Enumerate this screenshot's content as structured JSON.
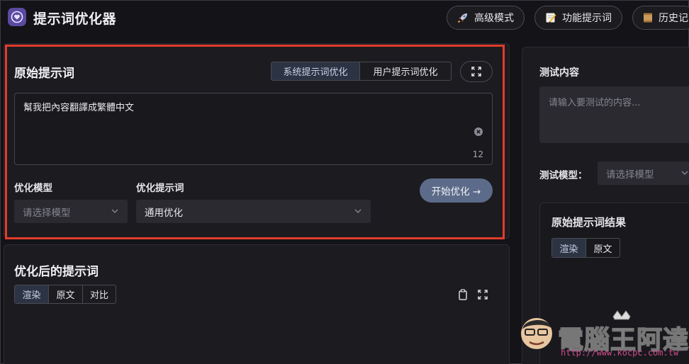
{
  "header": {
    "title": "提示词优化器",
    "buttons": [
      {
        "label": "高级模式",
        "icon": "rocket-icon"
      },
      {
        "label": "功能提示词",
        "icon": "pencil-icon"
      },
      {
        "label": "历史记",
        "icon": "scroll-icon"
      }
    ]
  },
  "original": {
    "title": "原始提示词",
    "tabs": [
      "系统提示词优化",
      "用户提示词优化"
    ],
    "active_tab": 0,
    "input_value": "幫我把內容翻譯成繁體中文",
    "char_count": "12",
    "model_label": "优化模型",
    "model_placeholder": "请选择模型",
    "template_label": "优化提示词",
    "template_value": "通用优化",
    "start_button": "开始优化 →"
  },
  "optimized": {
    "title": "优化后的提示词",
    "tabs": [
      "渲染",
      "原文",
      "对比"
    ],
    "active_tab": 0
  },
  "test": {
    "title": "测试内容",
    "input_placeholder": "请输入要测试的内容...",
    "model_label": "测试模型：",
    "model_placeholder": "请选择模型",
    "result_title": "原始提示词结果",
    "result_tabs": [
      "渲染",
      "原文"
    ],
    "result_active_tab": 0
  },
  "watermark": {
    "name": "電腦王阿達",
    "url": "http://www.kocpc.com.tw"
  },
  "colors": {
    "background": "#131318",
    "panel": "#1b1b20",
    "highlight": "#e33b2b",
    "accent_button": "#5c6b89",
    "active_tab": "#2c3444"
  }
}
